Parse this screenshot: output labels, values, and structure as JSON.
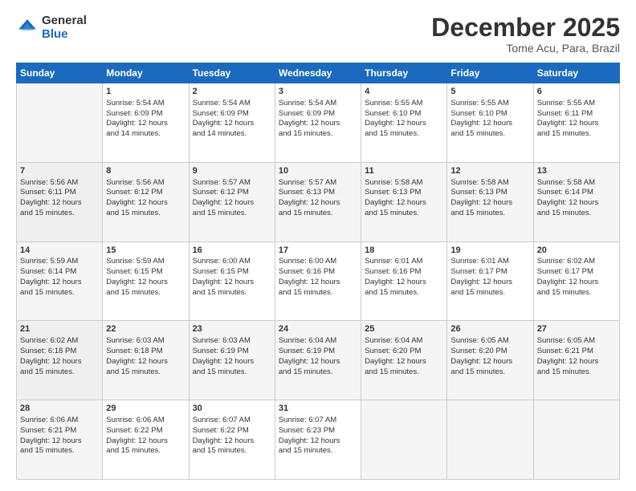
{
  "logo": {
    "general": "General",
    "blue": "Blue"
  },
  "header": {
    "month": "December 2025",
    "location": "Tome Acu, Para, Brazil"
  },
  "days_of_week": [
    "Sunday",
    "Monday",
    "Tuesday",
    "Wednesday",
    "Thursday",
    "Friday",
    "Saturday"
  ],
  "weeks": [
    [
      {
        "day": "",
        "info": ""
      },
      {
        "day": "1",
        "info": "Sunrise: 5:54 AM\nSunset: 6:09 PM\nDaylight: 12 hours\nand 14 minutes."
      },
      {
        "day": "2",
        "info": "Sunrise: 5:54 AM\nSunset: 6:09 PM\nDaylight: 12 hours\nand 14 minutes."
      },
      {
        "day": "3",
        "info": "Sunrise: 5:54 AM\nSunset: 6:09 PM\nDaylight: 12 hours\nand 15 minutes."
      },
      {
        "day": "4",
        "info": "Sunrise: 5:55 AM\nSunset: 6:10 PM\nDaylight: 12 hours\nand 15 minutes."
      },
      {
        "day": "5",
        "info": "Sunrise: 5:55 AM\nSunset: 6:10 PM\nDaylight: 12 hours\nand 15 minutes."
      },
      {
        "day": "6",
        "info": "Sunrise: 5:55 AM\nSunset: 6:11 PM\nDaylight: 12 hours\nand 15 minutes."
      }
    ],
    [
      {
        "day": "7",
        "info": "Sunrise: 5:56 AM\nSunset: 6:11 PM\nDaylight: 12 hours\nand 15 minutes."
      },
      {
        "day": "8",
        "info": "Sunrise: 5:56 AM\nSunset: 6:12 PM\nDaylight: 12 hours\nand 15 minutes."
      },
      {
        "day": "9",
        "info": "Sunrise: 5:57 AM\nSunset: 6:12 PM\nDaylight: 12 hours\nand 15 minutes."
      },
      {
        "day": "10",
        "info": "Sunrise: 5:57 AM\nSunset: 6:13 PM\nDaylight: 12 hours\nand 15 minutes."
      },
      {
        "day": "11",
        "info": "Sunrise: 5:58 AM\nSunset: 6:13 PM\nDaylight: 12 hours\nand 15 minutes."
      },
      {
        "day": "12",
        "info": "Sunrise: 5:58 AM\nSunset: 6:13 PM\nDaylight: 12 hours\nand 15 minutes."
      },
      {
        "day": "13",
        "info": "Sunrise: 5:58 AM\nSunset: 6:14 PM\nDaylight: 12 hours\nand 15 minutes."
      }
    ],
    [
      {
        "day": "14",
        "info": "Sunrise: 5:59 AM\nSunset: 6:14 PM\nDaylight: 12 hours\nand 15 minutes."
      },
      {
        "day": "15",
        "info": "Sunrise: 5:59 AM\nSunset: 6:15 PM\nDaylight: 12 hours\nand 15 minutes."
      },
      {
        "day": "16",
        "info": "Sunrise: 6:00 AM\nSunset: 6:15 PM\nDaylight: 12 hours\nand 15 minutes."
      },
      {
        "day": "17",
        "info": "Sunrise: 6:00 AM\nSunset: 6:16 PM\nDaylight: 12 hours\nand 15 minutes."
      },
      {
        "day": "18",
        "info": "Sunrise: 6:01 AM\nSunset: 6:16 PM\nDaylight: 12 hours\nand 15 minutes."
      },
      {
        "day": "19",
        "info": "Sunrise: 6:01 AM\nSunset: 6:17 PM\nDaylight: 12 hours\nand 15 minutes."
      },
      {
        "day": "20",
        "info": "Sunrise: 6:02 AM\nSunset: 6:17 PM\nDaylight: 12 hours\nand 15 minutes."
      }
    ],
    [
      {
        "day": "21",
        "info": "Sunrise: 6:02 AM\nSunset: 6:18 PM\nDaylight: 12 hours\nand 15 minutes."
      },
      {
        "day": "22",
        "info": "Sunrise: 6:03 AM\nSunset: 6:18 PM\nDaylight: 12 hours\nand 15 minutes."
      },
      {
        "day": "23",
        "info": "Sunrise: 6:03 AM\nSunset: 6:19 PM\nDaylight: 12 hours\nand 15 minutes."
      },
      {
        "day": "24",
        "info": "Sunrise: 6:04 AM\nSunset: 6:19 PM\nDaylight: 12 hours\nand 15 minutes."
      },
      {
        "day": "25",
        "info": "Sunrise: 6:04 AM\nSunset: 6:20 PM\nDaylight: 12 hours\nand 15 minutes."
      },
      {
        "day": "26",
        "info": "Sunrise: 6:05 AM\nSunset: 6:20 PM\nDaylight: 12 hours\nand 15 minutes."
      },
      {
        "day": "27",
        "info": "Sunrise: 6:05 AM\nSunset: 6:21 PM\nDaylight: 12 hours\nand 15 minutes."
      }
    ],
    [
      {
        "day": "28",
        "info": "Sunrise: 6:06 AM\nSunset: 6:21 PM\nDaylight: 12 hours\nand 15 minutes."
      },
      {
        "day": "29",
        "info": "Sunrise: 6:06 AM\nSunset: 6:22 PM\nDaylight: 12 hours\nand 15 minutes."
      },
      {
        "day": "30",
        "info": "Sunrise: 6:07 AM\nSunset: 6:22 PM\nDaylight: 12 hours\nand 15 minutes."
      },
      {
        "day": "31",
        "info": "Sunrise: 6:07 AM\nSunset: 6:23 PM\nDaylight: 12 hours\nand 15 minutes."
      },
      {
        "day": "",
        "info": ""
      },
      {
        "day": "",
        "info": ""
      },
      {
        "day": "",
        "info": ""
      }
    ]
  ]
}
